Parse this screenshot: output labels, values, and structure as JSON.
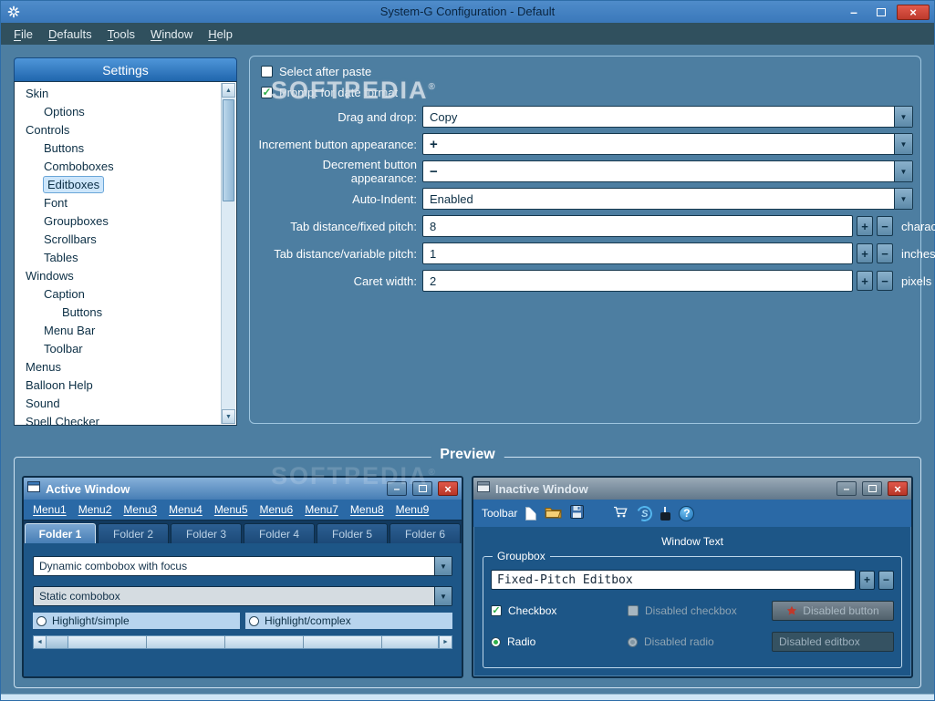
{
  "window": {
    "title": "System-G Configuration - Default"
  },
  "menubar": {
    "items": [
      "File",
      "Defaults",
      "Tools",
      "Window",
      "Help"
    ]
  },
  "watermark": {
    "text": "SOFTPEDIA",
    "reg": "®"
  },
  "glyphs": {
    "check": "✓",
    "plus": "+",
    "minus": "−",
    "dropdown": "▼",
    "up": "▲",
    "down": "▼",
    "left": "◄",
    "right": "►",
    "close": "×",
    "min": "–",
    "browser_letter": "S",
    "help": "?"
  },
  "sidebar": {
    "header": "Settings",
    "items": [
      {
        "label": "Skin",
        "indent": 0,
        "selected": false
      },
      {
        "label": "Options",
        "indent": 1,
        "selected": false
      },
      {
        "label": "Controls",
        "indent": 0,
        "selected": false
      },
      {
        "label": "Buttons",
        "indent": 1,
        "selected": false
      },
      {
        "label": "Comboboxes",
        "indent": 1,
        "selected": false
      },
      {
        "label": "Editboxes",
        "indent": 1,
        "selected": true
      },
      {
        "label": "Font",
        "indent": 1,
        "selected": false
      },
      {
        "label": "Groupboxes",
        "indent": 1,
        "selected": false
      },
      {
        "label": "Scrollbars",
        "indent": 1,
        "selected": false
      },
      {
        "label": "Tables",
        "indent": 1,
        "selected": false
      },
      {
        "label": "Windows",
        "indent": 0,
        "selected": false
      },
      {
        "label": "Caption",
        "indent": 1,
        "selected": false
      },
      {
        "label": "Buttons",
        "indent": 2,
        "selected": false
      },
      {
        "label": "Menu Bar",
        "indent": 1,
        "selected": false
      },
      {
        "label": "Toolbar",
        "indent": 1,
        "selected": false
      },
      {
        "label": "Menus",
        "indent": 0,
        "selected": false
      },
      {
        "label": "Balloon Help",
        "indent": 0,
        "selected": false
      },
      {
        "label": "Sound",
        "indent": 0,
        "selected": false
      },
      {
        "label": "Spell Checker",
        "indent": 0,
        "selected": false
      }
    ]
  },
  "form": {
    "select_after_paste": {
      "label": "Select after paste",
      "checked": false
    },
    "prompt_date_format": {
      "label": "Prompt for date format",
      "checked": true
    },
    "drag_and_drop": {
      "label": "Drag and drop:",
      "value": "Copy"
    },
    "increment": {
      "label": "Increment button appearance:",
      "value": "+"
    },
    "decrement": {
      "label": "Decrement button appearance:",
      "value": "−"
    },
    "auto_indent": {
      "label": "Auto-Indent:",
      "value": "Enabled"
    },
    "tab_fixed": {
      "label": "Tab distance/fixed pitch:",
      "value": "8",
      "unit": "characters"
    },
    "tab_variable": {
      "label": "Tab distance/variable pitch:",
      "value": "1",
      "unit": "inches"
    },
    "caret_width": {
      "label": "Caret width:",
      "value": "2",
      "unit": "pixels"
    }
  },
  "preview": {
    "title": "Preview",
    "active": {
      "title": "Active Window",
      "menus": [
        "Menu1",
        "Menu2",
        "Menu3",
        "Menu4",
        "Menu5",
        "Menu6",
        "Menu7",
        "Menu8",
        "Menu9"
      ],
      "tabs": [
        "Folder 1",
        "Folder 2",
        "Folder 3",
        "Folder 4",
        "Folder 5",
        "Folder 6"
      ],
      "combo_focus": "Dynamic combobox with focus",
      "combo_static": "Static combobox",
      "radio_simple": "Highlight/simple",
      "radio_complex": "Highlight/complex"
    },
    "inactive": {
      "title": "Inactive Window",
      "toolbar_label": "Toolbar",
      "window_text": "Window Text",
      "groupbox": "Groupbox",
      "editbox": "Fixed-Pitch Editbox",
      "checkbox": "Checkbox",
      "disabled_checkbox": "Disabled checkbox",
      "disabled_button": "Disabled button",
      "radio": "Radio",
      "disabled_radio": "Disabled radio",
      "disabled_editbox": "Disabled editbox"
    }
  }
}
